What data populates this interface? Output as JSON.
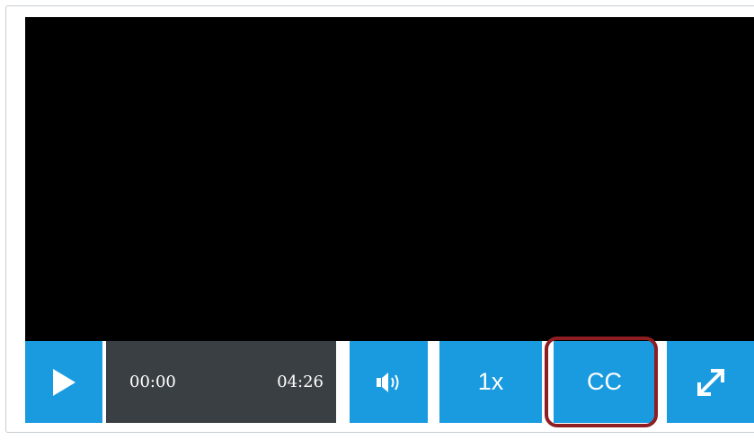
{
  "player": {
    "current_time": "00:00",
    "duration": "04:26",
    "speed_label": "1x",
    "captions_label": "CC"
  },
  "icons": {
    "play": "play-icon",
    "volume": "volume-icon",
    "fullscreen": "fullscreen-icon"
  },
  "colors": {
    "button_blue": "#1a9be0",
    "time_panel": "#3a3f44",
    "video_bg": "#000000",
    "highlight": "#8e1e22"
  }
}
